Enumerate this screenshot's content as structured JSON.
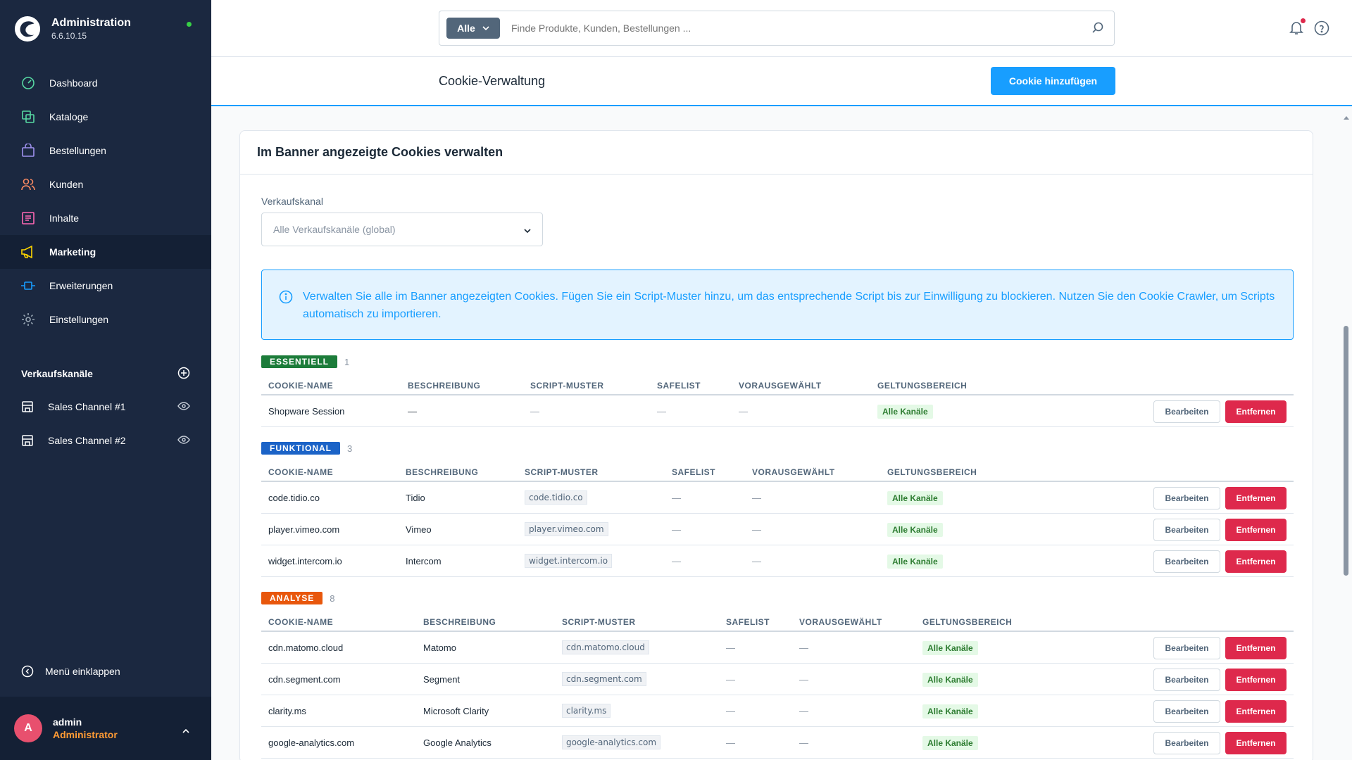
{
  "app": {
    "title": "Administration",
    "version": "6.6.10.15",
    "status_color": "#37d046"
  },
  "nav": {
    "items": [
      {
        "label": "Dashboard",
        "icon": "gauge-icon",
        "color": "#57d9a3"
      },
      {
        "label": "Kataloge",
        "icon": "catalog-icon",
        "color": "#57d9a3"
      },
      {
        "label": "Bestellungen",
        "icon": "shopping-bag-icon",
        "color": "#a092f0"
      },
      {
        "label": "Kunden",
        "icon": "users-icon",
        "color": "#f88962"
      },
      {
        "label": "Inhalte",
        "icon": "content-icon",
        "color": "#ff68b4"
      },
      {
        "label": "Marketing",
        "icon": "megaphone-icon",
        "color": "#ffd700"
      },
      {
        "label": "Erweiterungen",
        "icon": "plug-icon",
        "color": "#189eff"
      },
      {
        "label": "Einstellungen",
        "icon": "gear-icon",
        "color": "#9aa8b5"
      }
    ],
    "active_index": 5
  },
  "sales_channels": {
    "title": "Verkaufskanäle",
    "items": [
      {
        "label": "Sales Channel #1"
      },
      {
        "label": "Sales Channel #2"
      }
    ]
  },
  "collapse_label": "Menü einklappen",
  "user": {
    "initial": "A",
    "name": "admin",
    "role": "Administrator"
  },
  "search": {
    "type_label": "Alle",
    "placeholder": "Finde Produkte, Kunden, Bestellungen ..."
  },
  "page": {
    "title": "Cookie-Verwaltung",
    "add_button": "Cookie hinzufügen"
  },
  "card": {
    "title": "Im Banner angezeigte Cookies verwalten",
    "channel_label": "Verkaufskanal",
    "channel_value": "Alle Verkaufskanäle (global)",
    "info": "Verwalten Sie alle im Banner angezeigten Cookies. Fügen Sie ein Script-Muster hinzu, um das entsprechende Script bis zur Einwilligung zu blockieren. Nutzen Sie den Cookie Crawler, um Scripts automatisch zu importieren."
  },
  "columns": {
    "name": "COOKIE-NAME",
    "description": "BESCHREIBUNG",
    "pattern": "SCRIPT-MUSTER",
    "safelist": "SAFELIST",
    "preselected": "VORAUSGEWÄHLT",
    "scope": "GELTUNGSBEREICH"
  },
  "actions": {
    "edit": "Bearbeiten",
    "remove": "Entfernen"
  },
  "dash": "—",
  "groups": [
    {
      "badge": "ESSENTIELL",
      "count": "1",
      "color": "#1c7c3a",
      "rows": [
        {
          "name": "Shopware Session",
          "description": "—",
          "pattern": "",
          "scope": "Alle Kanäle"
        }
      ]
    },
    {
      "badge": "FUNKTIONAL",
      "count": "3",
      "color": "#1b63c7",
      "rows": [
        {
          "name": "code.tidio.co",
          "description": "Tidio",
          "pattern": "code.tidio.co",
          "scope": "Alle Kanäle"
        },
        {
          "name": "player.vimeo.com",
          "description": "Vimeo",
          "pattern": "player.vimeo.com",
          "scope": "Alle Kanäle"
        },
        {
          "name": "widget.intercom.io",
          "description": "Intercom",
          "pattern": "widget.intercom.io",
          "scope": "Alle Kanäle"
        }
      ]
    },
    {
      "badge": "ANALYSE",
      "count": "8",
      "color": "#e8570c",
      "rows": [
        {
          "name": "cdn.matomo.cloud",
          "description": "Matomo",
          "pattern": "cdn.matomo.cloud",
          "scope": "Alle Kanäle"
        },
        {
          "name": "cdn.segment.com",
          "description": "Segment",
          "pattern": "cdn.segment.com",
          "scope": "Alle Kanäle"
        },
        {
          "name": "clarity.ms",
          "description": "Microsoft Clarity",
          "pattern": "clarity.ms",
          "scope": "Alle Kanäle"
        },
        {
          "name": "google-analytics.com",
          "description": "Google Analytics",
          "pattern": "google-analytics.com",
          "scope": "Alle Kanäle"
        }
      ]
    }
  ]
}
